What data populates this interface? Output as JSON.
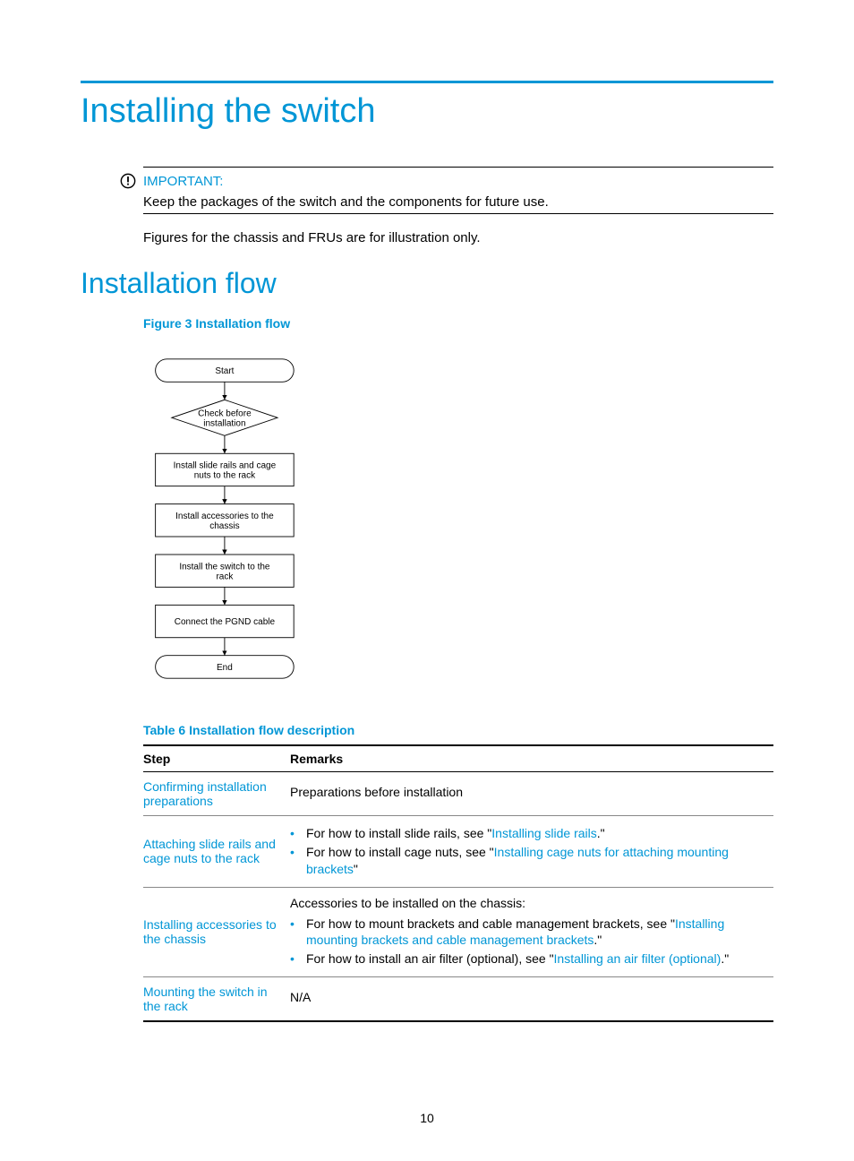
{
  "page": {
    "number": "10",
    "h1": "Installing the switch",
    "h2": "Installation flow",
    "figure_caption": "Figure 3 Installation flow",
    "table_caption": "Table 6 Installation flow description",
    "body_note": "Figures for the chassis and FRUs are for illustration only."
  },
  "important": {
    "label": "IMPORTANT:",
    "text": "Keep the packages of the switch and the components for future use."
  },
  "chart_data": {
    "type": "flowchart",
    "title": "Installation flow",
    "nodes": [
      {
        "id": "start",
        "shape": "terminator",
        "label": "Start"
      },
      {
        "id": "check",
        "shape": "decision",
        "label": "Check before installation"
      },
      {
        "id": "rails",
        "shape": "process",
        "label": "Install slide rails and cage nuts to the rack"
      },
      {
        "id": "acc",
        "shape": "process",
        "label": "Install accessories to the chassis"
      },
      {
        "id": "mount",
        "shape": "process",
        "label": "Install the switch to the rack"
      },
      {
        "id": "pgnd",
        "shape": "process",
        "label": "Connect the PGND cable"
      },
      {
        "id": "end",
        "shape": "terminator",
        "label": "End"
      }
    ],
    "edges": [
      [
        "start",
        "check"
      ],
      [
        "check",
        "rails"
      ],
      [
        "rails",
        "acc"
      ],
      [
        "acc",
        "mount"
      ],
      [
        "mount",
        "pgnd"
      ],
      [
        "pgnd",
        "end"
      ]
    ]
  },
  "table": {
    "headers": {
      "step": "Step",
      "remarks": "Remarks"
    },
    "rows": [
      {
        "step_link": "Confirming installation preparations",
        "remarks_lead": "Preparations before installation",
        "bullets": []
      },
      {
        "step_link": "Attaching slide rails and cage nuts to the rack",
        "remarks_lead": "",
        "bullets": [
          {
            "pre": "For how to install slide rails, see \"",
            "link": "Installing slide rails",
            "post": ".\""
          },
          {
            "pre": "For how to install cage nuts, see \"",
            "link": "Installing cage nuts for attaching mounting brackets",
            "post": "\""
          }
        ]
      },
      {
        "step_link": "Installing accessories to the chassis",
        "remarks_lead": "Accessories to be installed on the chassis:",
        "bullets": [
          {
            "pre": "For how to mount brackets and cable management brackets, see \"",
            "link": "Installing mounting brackets and cable management brackets",
            "post": ".\""
          },
          {
            "pre": "For how to install an air filter (optional), see \"",
            "link": "Installing an air filter (optional)",
            "post": ".\""
          }
        ]
      },
      {
        "step_link": "Mounting the switch in the rack",
        "remarks_lead": "N/A",
        "bullets": []
      }
    ]
  }
}
